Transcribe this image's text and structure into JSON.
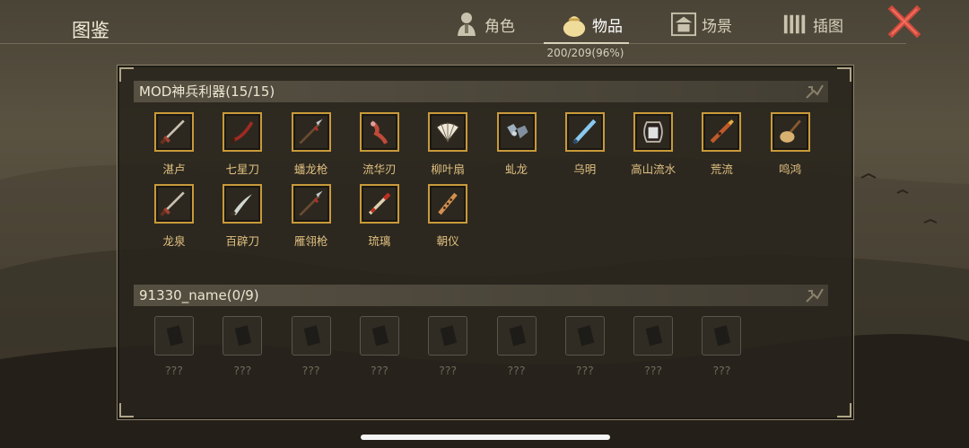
{
  "header": {
    "title": "图鉴",
    "progress": "200/209(96%)",
    "tabs": [
      {
        "label": "角色",
        "icon": "character-icon",
        "active": false
      },
      {
        "label": "物品",
        "icon": "item-bag-icon",
        "active": true
      },
      {
        "label": "场景",
        "icon": "scene-icon",
        "active": false
      },
      {
        "label": "插图",
        "icon": "illustration-icon",
        "active": false
      }
    ],
    "close_icon": "close-icon"
  },
  "sections": [
    {
      "title": "MOD神兵利器(15/15)",
      "items": [
        {
          "label": "湛卢",
          "icon": "sword-icon",
          "locked": false
        },
        {
          "label": "七星刀",
          "icon": "curved-blade-icon",
          "locked": false
        },
        {
          "label": "蟠龙枪",
          "icon": "spear-icon",
          "locked": false
        },
        {
          "label": "流华刃",
          "icon": "flower-blade-icon",
          "locked": false
        },
        {
          "label": "柳叶扇",
          "icon": "fan-icon",
          "locked": false
        },
        {
          "label": "虬龙",
          "icon": "gauntlet-icon",
          "locked": false
        },
        {
          "label": "乌明",
          "icon": "blue-sword-icon",
          "locked": false
        },
        {
          "label": "高山流水",
          "icon": "harp-icon",
          "locked": false
        },
        {
          "label": "荒流",
          "icon": "flute-icon",
          "locked": false
        },
        {
          "label": "鸣鸿",
          "icon": "pipa-icon",
          "locked": false
        },
        {
          "label": "龙泉",
          "icon": "sword-icon",
          "locked": false
        },
        {
          "label": "百辟刀",
          "icon": "saber-icon",
          "locked": false
        },
        {
          "label": "雁翎枪",
          "icon": "spear-icon",
          "locked": false
        },
        {
          "label": "琉璃",
          "icon": "staff-icon",
          "locked": false
        },
        {
          "label": "朝仪",
          "icon": "xiao-flute-icon",
          "locked": false
        }
      ]
    },
    {
      "title": "91330_name(0/9)",
      "items": [
        {
          "label": "???",
          "icon": "locked-card-icon",
          "locked": true
        },
        {
          "label": "???",
          "icon": "locked-card-icon",
          "locked": true
        },
        {
          "label": "???",
          "icon": "locked-card-icon",
          "locked": true
        },
        {
          "label": "???",
          "icon": "locked-card-icon",
          "locked": true
        },
        {
          "label": "???",
          "icon": "locked-card-icon",
          "locked": true
        },
        {
          "label": "???",
          "icon": "locked-card-icon",
          "locked": true
        },
        {
          "label": "???",
          "icon": "locked-card-icon",
          "locked": true
        },
        {
          "label": "???",
          "icon": "locked-card-icon",
          "locked": true
        },
        {
          "label": "???",
          "icon": "locked-card-icon",
          "locked": true
        }
      ]
    }
  ],
  "colors": {
    "slot_border": "#c89a3a",
    "label": "#e0c080",
    "locked_label": "#6e6858"
  }
}
